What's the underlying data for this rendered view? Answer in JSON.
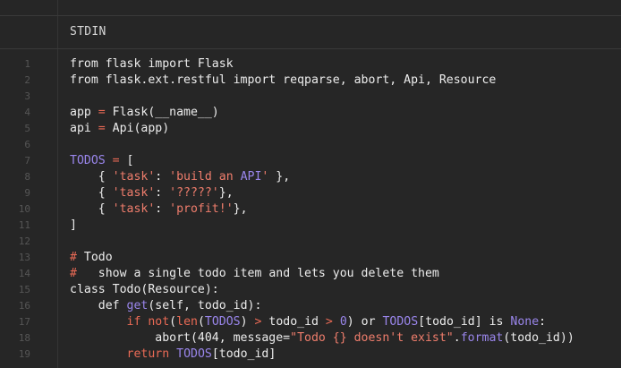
{
  "header": {
    "title": "STDIN"
  },
  "colors": {
    "background": "#262626",
    "text": "#ededed",
    "line_number": "#555555",
    "keyword": "#e96a55",
    "string": "#ef7d6c",
    "builtin": "#9a86ec"
  },
  "lines": [
    {
      "n": "1",
      "tokens": [
        [
          "t",
          "from flask import Flask"
        ]
      ]
    },
    {
      "n": "2",
      "tokens": [
        [
          "t",
          "from flask.ext.restful import reqparse, abort, Api, Resource"
        ]
      ]
    },
    {
      "n": "3",
      "tokens": []
    },
    {
      "n": "4",
      "tokens": [
        [
          "t",
          "app "
        ],
        [
          "c",
          "="
        ],
        [
          "t",
          " Flask(__name__)"
        ]
      ]
    },
    {
      "n": "5",
      "tokens": [
        [
          "t",
          "api "
        ],
        [
          "c",
          "="
        ],
        [
          "t",
          " Api(app)"
        ]
      ]
    },
    {
      "n": "6",
      "tokens": []
    },
    {
      "n": "7",
      "tokens": [
        [
          "b",
          "TODOS"
        ],
        [
          "t",
          " "
        ],
        [
          "c",
          "="
        ],
        [
          "t",
          " ["
        ]
      ]
    },
    {
      "n": "8",
      "tokens": [
        [
          "t",
          "    { "
        ],
        [
          "s",
          "'task'"
        ],
        [
          "t",
          ": "
        ],
        [
          "s",
          "'build an "
        ],
        [
          "b",
          "API"
        ],
        [
          "s",
          "'"
        ],
        [
          "t",
          " },"
        ]
      ]
    },
    {
      "n": "9",
      "tokens": [
        [
          "t",
          "    { "
        ],
        [
          "s",
          "'task'"
        ],
        [
          "t",
          ": "
        ],
        [
          "s",
          "'?????'"
        ],
        [
          "t",
          "},"
        ]
      ]
    },
    {
      "n": "10",
      "tokens": [
        [
          "t",
          "    { "
        ],
        [
          "s",
          "'task'"
        ],
        [
          "t",
          ": "
        ],
        [
          "s",
          "'profit!'"
        ],
        [
          "t",
          "},"
        ]
      ]
    },
    {
      "n": "11",
      "tokens": [
        [
          "t",
          "]"
        ]
      ]
    },
    {
      "n": "12",
      "tokens": []
    },
    {
      "n": "13",
      "tokens": [
        [
          "c",
          "#"
        ],
        [
          "t",
          " Todo"
        ]
      ]
    },
    {
      "n": "14",
      "tokens": [
        [
          "c",
          "#"
        ],
        [
          "t",
          "   show a single todo item and lets you delete them"
        ]
      ]
    },
    {
      "n": "15",
      "tokens": [
        [
          "t",
          "class Todo(Resource):"
        ]
      ]
    },
    {
      "n": "16",
      "tokens": [
        [
          "t",
          "    def "
        ],
        [
          "b",
          "get"
        ],
        [
          "t",
          "(self, todo_id):"
        ]
      ]
    },
    {
      "n": "17",
      "tokens": [
        [
          "t",
          "        "
        ],
        [
          "c",
          "if not"
        ],
        [
          "t",
          "("
        ],
        [
          "c",
          "len"
        ],
        [
          "t",
          "("
        ],
        [
          "b",
          "TODOS"
        ],
        [
          "t",
          ") "
        ],
        [
          "c",
          ">"
        ],
        [
          "t",
          " todo_id "
        ],
        [
          "c",
          ">"
        ],
        [
          "t",
          " "
        ],
        [
          "b",
          "0"
        ],
        [
          "t",
          ") or "
        ],
        [
          "b",
          "TODOS"
        ],
        [
          "t",
          "[todo_id] is "
        ],
        [
          "b",
          "None"
        ],
        [
          "t",
          ":"
        ]
      ]
    },
    {
      "n": "18",
      "tokens": [
        [
          "t",
          "            abort(404, message="
        ],
        [
          "s",
          "\"Todo {} doesn't exist\""
        ],
        [
          "t",
          "."
        ],
        [
          "b",
          "format"
        ],
        [
          "t",
          "(todo_id))"
        ]
      ]
    },
    {
      "n": "19",
      "tokens": [
        [
          "t",
          "        "
        ],
        [
          "c",
          "return"
        ],
        [
          "t",
          " "
        ],
        [
          "b",
          "TODOS"
        ],
        [
          "t",
          "[todo_id]"
        ]
      ]
    }
  ]
}
